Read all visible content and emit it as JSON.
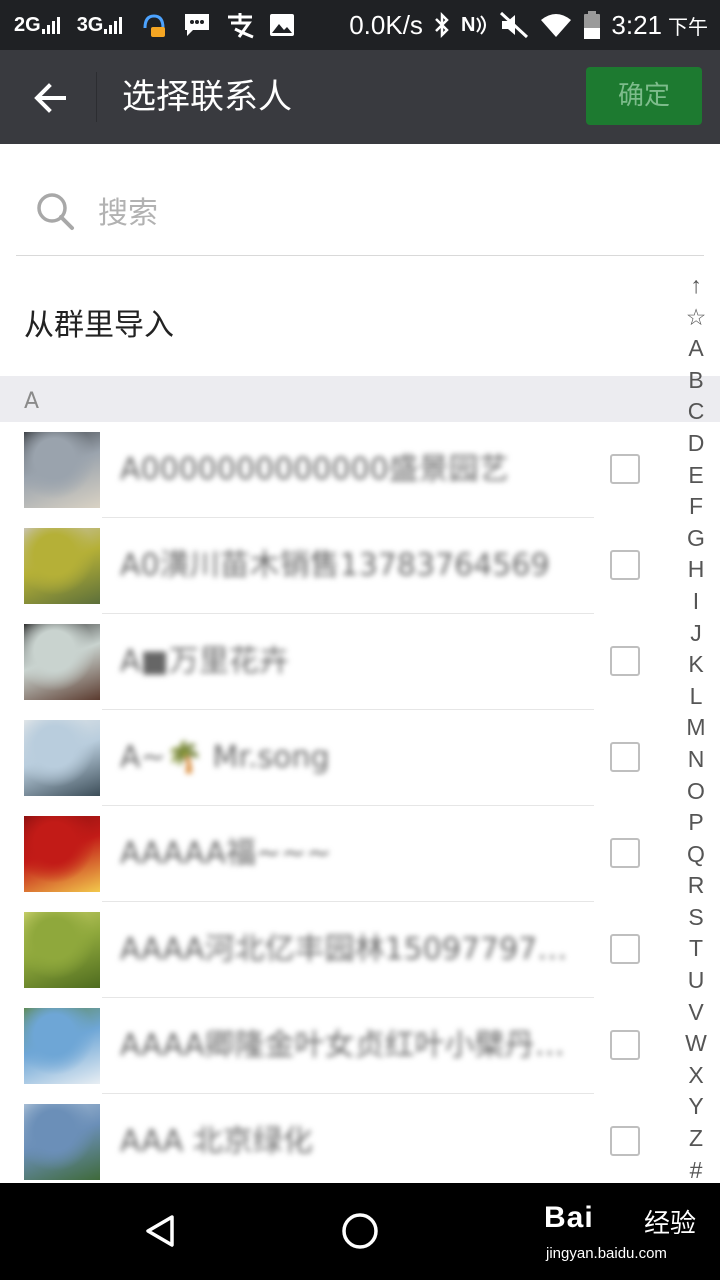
{
  "status_bar": {
    "signal1": "2G",
    "signal2": "3G",
    "net_speed": "0.0K/s",
    "nfc": "N",
    "time": "3:21",
    "ampm": "下午"
  },
  "header": {
    "title": "选择联系人",
    "confirm_label": "确定"
  },
  "search": {
    "placeholder": "搜索",
    "value": ""
  },
  "import_group_label": "从群里导入",
  "section_letter": "A",
  "contacts": [
    {
      "name": "A0000000000000盛景园艺",
      "checked": false,
      "avatar_colors": [
        "#9aa3ad",
        "#d9d2c4",
        "#3b3f44"
      ]
    },
    {
      "name": "A0潢川苗木销售13783764569",
      "checked": false,
      "avatar_colors": [
        "#b5b037",
        "#5c6f3a",
        "#c9c4b8"
      ]
    },
    {
      "name": "A■万里花卉",
      "checked": false,
      "avatar_colors": [
        "#c9d3cf",
        "#5b3b2f",
        "#2b2b2b"
      ]
    },
    {
      "name": "A~🌴 Mr.song",
      "checked": false,
      "avatar_colors": [
        "#b9cddd",
        "#3c4d58",
        "#e2e6e8"
      ]
    },
    {
      "name": "AAAAA福~~~",
      "checked": false,
      "avatar_colors": [
        "#c21b17",
        "#f2c94c",
        "#8a1010"
      ]
    },
    {
      "name": "AAAA河北亿丰园林150977976…",
      "checked": false,
      "avatar_colors": [
        "#8fa83c",
        "#4e6b1f",
        "#c8cf6a"
      ]
    },
    {
      "name": "AAAA卿隆金叶女贞红叶小檗丹…",
      "checked": false,
      "avatar_colors": [
        "#6ea6d6",
        "#e8eef3",
        "#5f8a52"
      ]
    },
    {
      "name": "AAA 北京绿化",
      "checked": false,
      "avatar_colors": [
        "#6b8fb8",
        "#3f6a3a",
        "#a9bfd6"
      ]
    }
  ],
  "alphabet_index": [
    "↑",
    "☆",
    "A",
    "B",
    "C",
    "D",
    "E",
    "F",
    "G",
    "H",
    "I",
    "J",
    "K",
    "L",
    "M",
    "N",
    "O",
    "P",
    "Q",
    "R",
    "S",
    "T",
    "U",
    "V",
    "W",
    "X",
    "Y",
    "Z",
    "#"
  ],
  "watermark": {
    "logo": "Bai",
    "suffix": "经验",
    "url": "jingyan.baidu.com"
  },
  "colors": {
    "titlebar": "#393a3f",
    "confirm_bg": "#1d7a30",
    "section_bg": "#ececf0"
  }
}
